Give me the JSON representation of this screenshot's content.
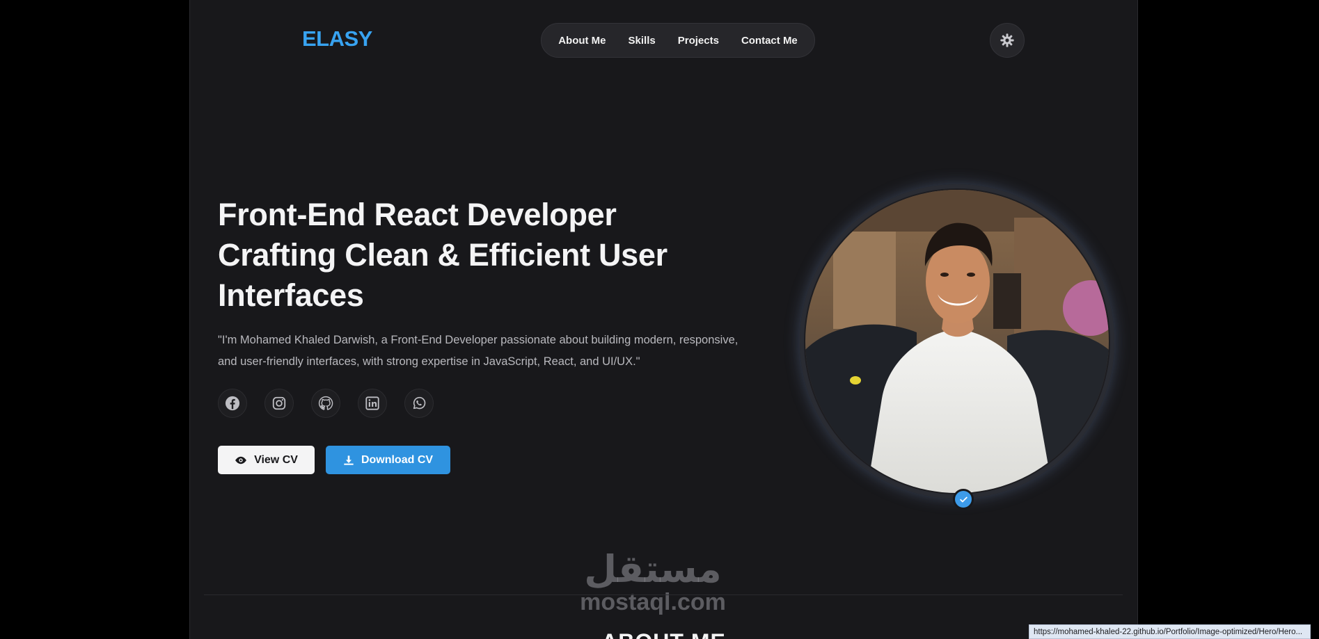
{
  "brand": {
    "logo": "ELASY",
    "accent": "#38a3f1"
  },
  "nav": {
    "items": [
      {
        "label": "About Me"
      },
      {
        "label": "Skills"
      },
      {
        "label": "Projects"
      },
      {
        "label": "Contact Me"
      }
    ]
  },
  "theme_toggle": {
    "icon": "gear-icon"
  },
  "hero": {
    "title_lines": [
      "Front-End React Developer",
      "Crafting Clean & Efficient User",
      "Interfaces"
    ],
    "description_lines": [
      "\"I'm Mohamed Khaled Darwish, a Front-End Developer passionate about building modern, responsive,",
      "and user-friendly interfaces, with strong expertise in JavaScript, React, and UI/UX.\""
    ],
    "socials": [
      {
        "icon": "facebook-icon"
      },
      {
        "icon": "instagram-icon"
      },
      {
        "icon": "github-icon"
      },
      {
        "icon": "linkedin-icon"
      },
      {
        "icon": "whatsapp-icon"
      }
    ],
    "buttons": {
      "view_cv": "View CV",
      "download_cv": "Download CV"
    }
  },
  "section": {
    "about_heading": "ABOUT ME"
  },
  "watermark": {
    "arabic": "مستقل",
    "latin": "mostaql.com"
  },
  "status_bar": {
    "url": "https://mohamed-khaled-22.github.io/Portfolio/Image-optimized/Hero/Hero..."
  },
  "colors": {
    "page_bg": "#18181b",
    "outer_bg": "#000000",
    "download_button": "#2f93e0",
    "verified_badge": "#3d9be9"
  }
}
